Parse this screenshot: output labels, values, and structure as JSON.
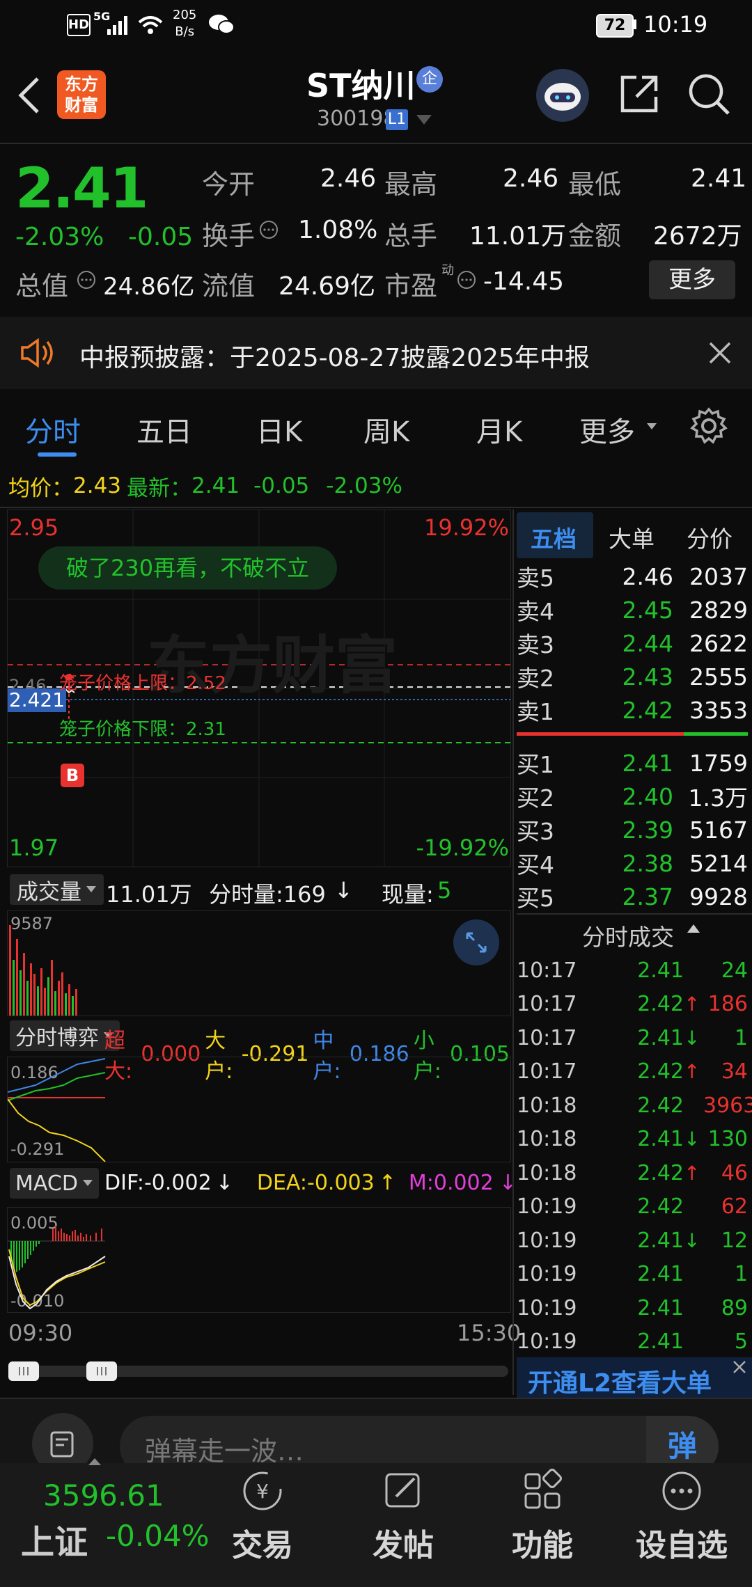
{
  "status_bar": {
    "network": "5G",
    "speed_top": "205",
    "speed_bottom": "B/s",
    "battery": "72",
    "time": "10:19"
  },
  "header": {
    "app_logo_line1": "东方",
    "app_logo_line2": "财富",
    "stock_name": "ST纳川",
    "badge": "企",
    "code": "300198",
    "level": "L1"
  },
  "quote": {
    "price": "2.41",
    "change_pct": "-2.03%",
    "change": "-0.05",
    "open_label": "今开",
    "open": "2.46",
    "high_label": "最高",
    "high": "2.46",
    "low_label": "最低",
    "low": "2.41",
    "turnover_label": "换手",
    "turnover": "1.08%",
    "volume_label": "总手",
    "volume": "11.01万",
    "amount_label": "金额",
    "amount": "2672万",
    "mktcap_label": "总值",
    "mktcap": "24.86亿",
    "float_label": "流值",
    "float": "24.69亿",
    "pe_label": "市盈",
    "pe_sup": "动",
    "pe": "-14.45",
    "more_button": "更多"
  },
  "notice": {
    "text": "中报预披露：于2025-08-27披露2025年中报"
  },
  "tabs": [
    "分时",
    "五日",
    "日K",
    "周K",
    "月K",
    "更多"
  ],
  "info_line": {
    "avg_label": "均价：",
    "avg": "2.43",
    "latest_label": "最新：",
    "latest": "2.41",
    "change": "-0.05",
    "change_pct": "-2.03%"
  },
  "chart": {
    "price_top": "2.95",
    "pct_top": "19.92%",
    "price_bottom": "1.97",
    "pct_bottom": "-19.92%",
    "current_tag": "2.421",
    "left_tick": "2.46",
    "comment": "破了230再看，不破不立",
    "cage_upper": "笼子价格上限：2.52",
    "cage_lower": "笼子价格下限：2.31",
    "marker": "B",
    "watermark": "东方财富",
    "time_start": "09:30",
    "time_end": "15:30"
  },
  "volume_panel": {
    "selector": "成交量",
    "total": "11.01万",
    "minute_label": "分时量:169",
    "current_label": "现量:",
    "current": "5",
    "max": "9587"
  },
  "game_panel": {
    "selector": "分时博弈",
    "super_label": "超大:",
    "super": "0.000",
    "big_label": "大户:",
    "big": "-0.291",
    "mid_label": "中户:",
    "mid": "0.186",
    "small_label": "小户:",
    "small": "0.105",
    "top_tick": "0.186",
    "bottom_tick": "-0.291"
  },
  "macd_panel": {
    "selector": "MACD",
    "dif": "DIF:-0.002",
    "dea": "DEA:-0.003",
    "m": "M:0.002",
    "top_tick": "0.005",
    "bottom_tick": "-0.010"
  },
  "orderbook": {
    "tabs": [
      "五档",
      "大单",
      "分价"
    ],
    "sells": [
      {
        "label": "卖5",
        "price": "2.46",
        "vol": "2037",
        "color": "white"
      },
      {
        "label": "卖4",
        "price": "2.45",
        "vol": "2829",
        "color": "green"
      },
      {
        "label": "卖3",
        "price": "2.44",
        "vol": "2622",
        "color": "green"
      },
      {
        "label": "卖2",
        "price": "2.43",
        "vol": "2555",
        "color": "green"
      },
      {
        "label": "卖1",
        "price": "2.42",
        "vol": "3353",
        "color": "green"
      }
    ],
    "buys": [
      {
        "label": "买1",
        "price": "2.41",
        "vol": "1759",
        "color": "green"
      },
      {
        "label": "买2",
        "price": "2.40",
        "vol": "1.3万",
        "color": "green"
      },
      {
        "label": "买3",
        "price": "2.39",
        "vol": "5167",
        "color": "green"
      },
      {
        "label": "买4",
        "price": "2.38",
        "vol": "5214",
        "color": "green"
      },
      {
        "label": "买5",
        "price": "2.37",
        "vol": "9928",
        "color": "green"
      }
    ]
  },
  "trades": {
    "title": "分时成交",
    "rows": [
      {
        "time": "10:17",
        "price": "2.41",
        "arrow": "",
        "vol": "24",
        "vcolor": "green"
      },
      {
        "time": "10:17",
        "price": "2.42",
        "arrow": "↑",
        "vol": "186",
        "vcolor": "red"
      },
      {
        "time": "10:17",
        "price": "2.41",
        "arrow": "↓",
        "vol": "1",
        "vcolor": "green"
      },
      {
        "time": "10:17",
        "price": "2.42",
        "arrow": "↑",
        "vol": "34",
        "vcolor": "red"
      },
      {
        "time": "10:18",
        "price": "2.42",
        "arrow": "",
        "vol": "3963",
        "vcolor": "red"
      },
      {
        "time": "10:18",
        "price": "2.41",
        "arrow": "↓",
        "vol": "130",
        "vcolor": "green"
      },
      {
        "time": "10:18",
        "price": "2.42",
        "arrow": "↑",
        "vol": "46",
        "vcolor": "red"
      },
      {
        "time": "10:19",
        "price": "2.42",
        "arrow": "",
        "vol": "62",
        "vcolor": "red"
      },
      {
        "time": "10:19",
        "price": "2.41",
        "arrow": "↓",
        "vol": "12",
        "vcolor": "green"
      },
      {
        "time": "10:19",
        "price": "2.41",
        "arrow": "",
        "vol": "1",
        "vcolor": "green"
      },
      {
        "time": "10:19",
        "price": "2.41",
        "arrow": "",
        "vol": "89",
        "vcolor": "green"
      },
      {
        "time": "10:19",
        "price": "2.41",
        "arrow": "",
        "vol": "5",
        "vcolor": "green"
      }
    ],
    "l2_banner": "开通L2查看大单"
  },
  "danmaku": {
    "placeholder": "弹幕走一波…",
    "button": "弹"
  },
  "bottom_nav": {
    "index_value": "3596.61",
    "index_name": "上证",
    "index_change": "-0.04%",
    "items": [
      "交易",
      "发帖",
      "功能",
      "设自选"
    ]
  },
  "colors": {
    "up": "#e8322f",
    "down": "#22c12b",
    "background": "#0c0c0c"
  }
}
